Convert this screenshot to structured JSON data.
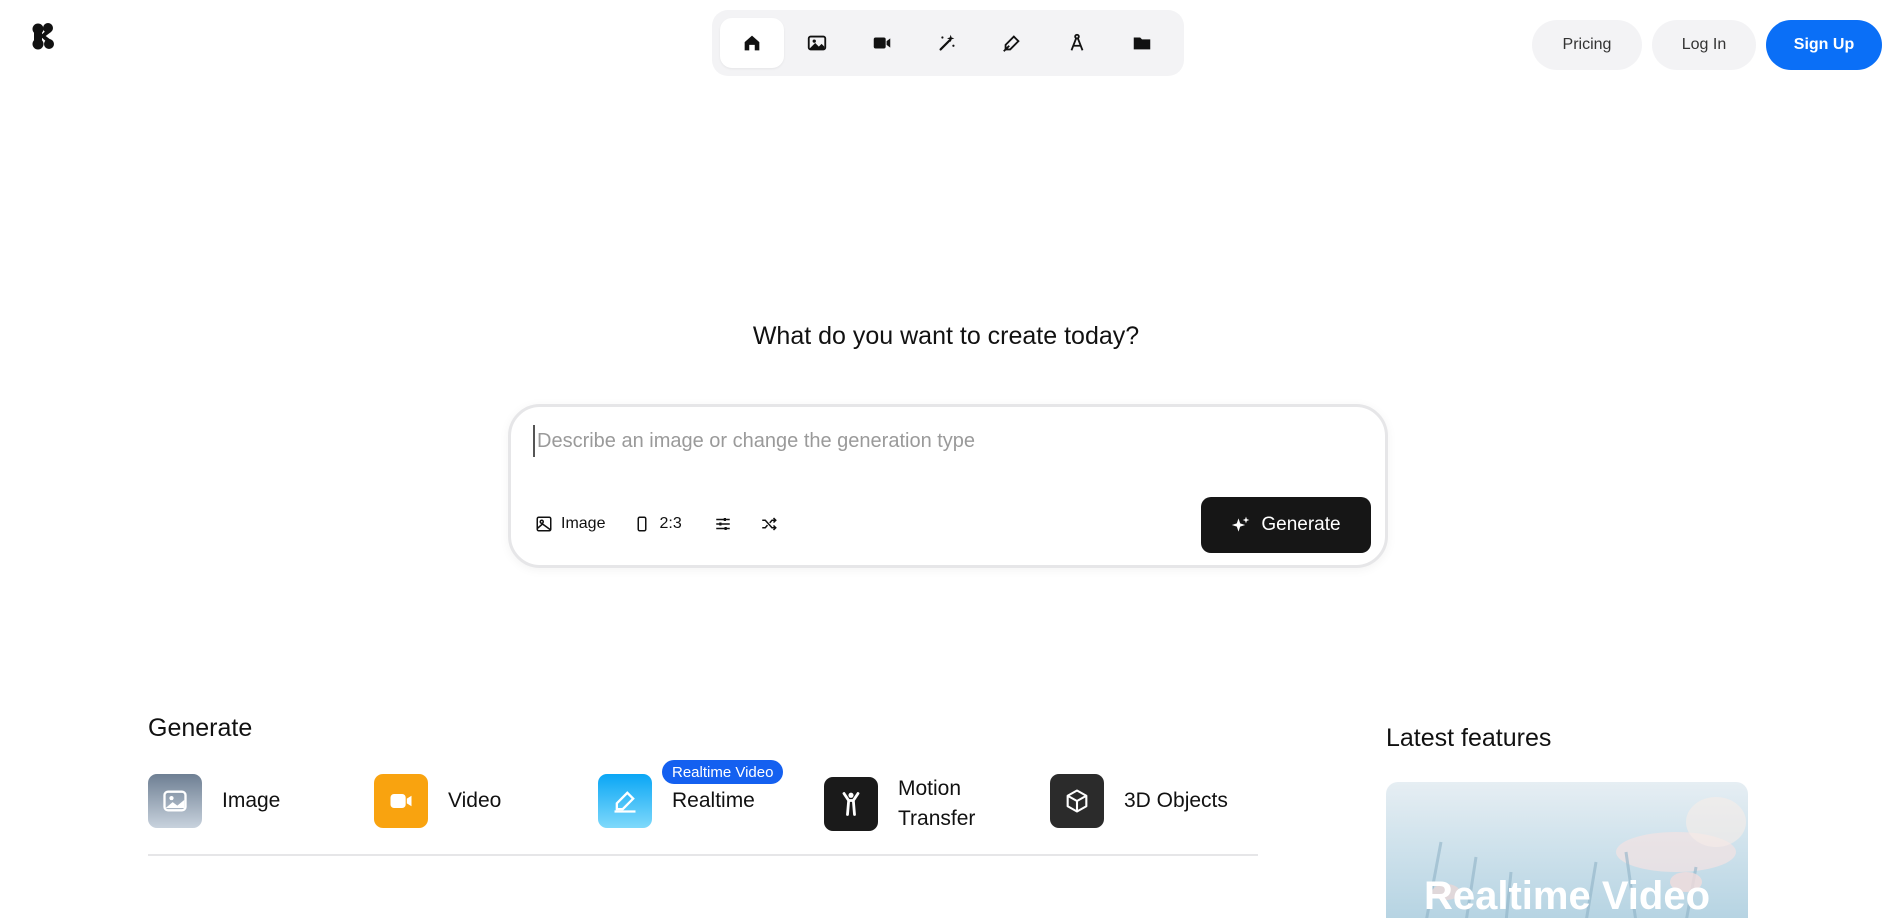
{
  "header": {
    "nav_icons": [
      "home-icon",
      "image-icon",
      "video-icon",
      "magic-wand-icon",
      "pen-brush-icon",
      "compass-icon",
      "folder-icon"
    ],
    "pricing_label": "Pricing",
    "login_label": "Log In",
    "signup_label": "Sign Up"
  },
  "colors": {
    "signup": "#0a6ff7",
    "generate": "#161616",
    "badge": "#1460f0",
    "video_tile": "#f9a30f",
    "realtime_tile": "#0fb2f4"
  },
  "main": {
    "headline": "What do you want to create today?",
    "prompt": {
      "placeholder": "Describe an image or change the generation type",
      "value": ""
    },
    "tools": {
      "type_label": "Image",
      "ratio_label": "2:3"
    },
    "generate_label": "Generate"
  },
  "generate_section": {
    "title": "Generate",
    "items": [
      {
        "label": "Image",
        "icon": "image-icon"
      },
      {
        "label": "Video",
        "icon": "video-camera-icon"
      },
      {
        "label": "Realtime",
        "icon": "realtime-brush-icon",
        "badge": "Realtime Video"
      },
      {
        "label": "Motion Transfer",
        "icon": "person-motion-icon"
      },
      {
        "label": "3D Objects",
        "icon": "cube-icon"
      }
    ]
  },
  "latest": {
    "title": "Latest features",
    "card_title": "Realtime Video"
  }
}
